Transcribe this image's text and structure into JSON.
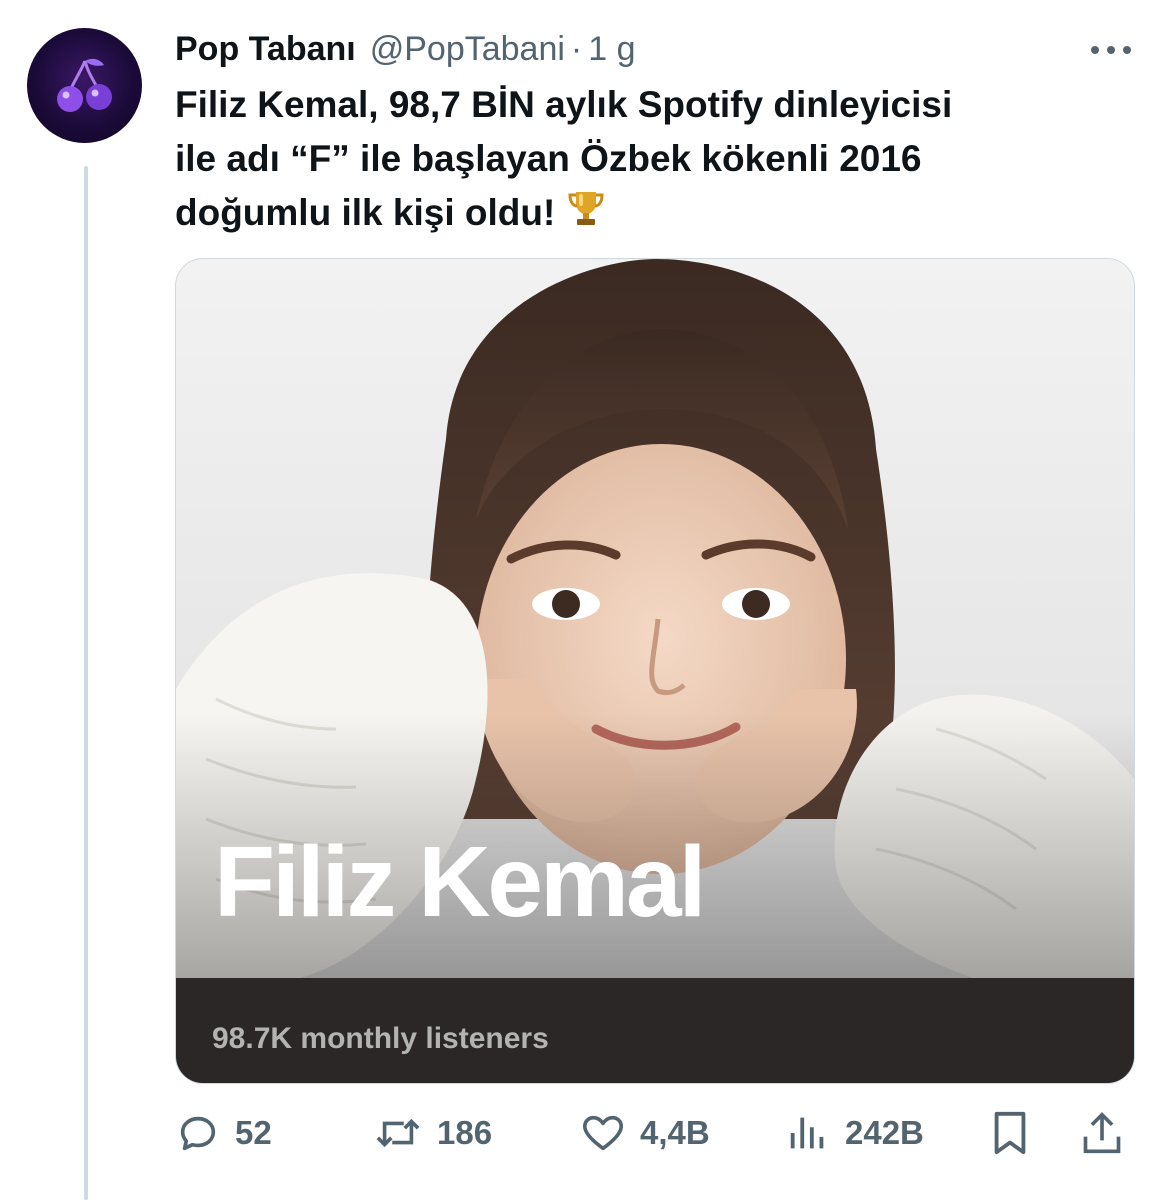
{
  "tweet": {
    "author_name": "Pop Tabanı",
    "author_handle": "@PopTabani",
    "separator": "·",
    "time": "1 g",
    "text_lines": [
      "Filiz Kemal, 98,7 BİN aylık Spotify dinleyicisi",
      "ile adı “F” ile başlayan Özbek kökenli 2016",
      "doğumlu ilk kişi oldu!"
    ],
    "emoji": "trophy"
  },
  "media": {
    "artist_name": "Filiz Kemal",
    "listeners": "98.7K monthly listeners"
  },
  "actions": {
    "replies": "52",
    "retweets": "186",
    "likes": "4,4B",
    "views": "242B"
  },
  "icons": {
    "avatar": "cherry-icon",
    "more": "more-icon",
    "reply": "reply-icon",
    "retweet": "retweet-icon",
    "like": "heart-icon",
    "views": "views-icon",
    "bookmark": "bookmark-icon",
    "share": "share-icon"
  },
  "colors": {
    "text": "#0f1419",
    "secondary": "#536471",
    "spotify_bar": "#2a2726",
    "avatar_bg": "#1c0b3a"
  }
}
